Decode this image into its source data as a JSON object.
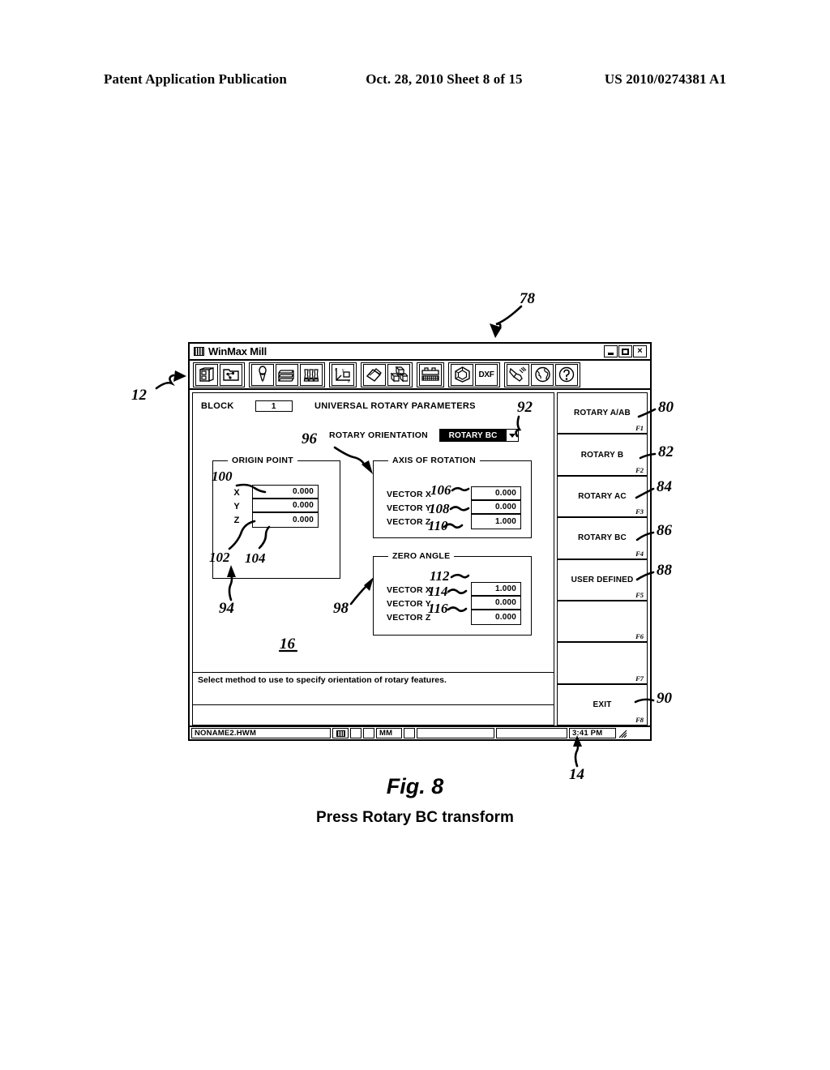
{
  "patent_header": {
    "left": "Patent Application Publication",
    "middle": "Oct. 28, 2010  Sheet 8 of 15",
    "right": "US 2010/0274381 A1"
  },
  "window": {
    "title": "WinMax Mill",
    "title_icon": "grid-app-icon",
    "controls": [
      {
        "name": "minimize-button",
        "glyph": "minimize"
      },
      {
        "name": "maximize-button",
        "glyph": "maximize"
      },
      {
        "name": "close-button",
        "glyph": "×"
      }
    ]
  },
  "toolbar": {
    "groups": [
      {
        "buttons": [
          {
            "name": "part-setup-icon",
            "icon": "part-setup"
          },
          {
            "name": "program-folder-icon",
            "icon": "program-folder"
          }
        ]
      },
      {
        "buttons": [
          {
            "name": "tool-probe-icon",
            "icon": "tool-probe"
          },
          {
            "name": "tool-table-icon",
            "icon": "tool-table"
          },
          {
            "name": "tool-group-icon",
            "icon": "tool-group"
          }
        ]
      },
      {
        "buttons": [
          {
            "name": "coordinate-axes-icon",
            "icon": "coordinate-axes"
          }
        ]
      },
      {
        "buttons": [
          {
            "name": "edit-program-icon",
            "icon": "edit-program"
          },
          {
            "name": "solid-blocks-icon",
            "icon": "solid-blocks"
          }
        ]
      },
      {
        "buttons": [
          {
            "name": "machine-table-icon",
            "icon": "machine-table"
          }
        ]
      },
      {
        "buttons": [
          {
            "name": "solid-model-icon",
            "icon": "solid-model"
          },
          {
            "name": "dxf-import-icon",
            "icon": "dxf",
            "label": "DXF"
          }
        ]
      },
      {
        "buttons": [
          {
            "name": "manual-hand-icon",
            "icon": "manual-hand"
          },
          {
            "name": "globe-icon",
            "icon": "globe"
          },
          {
            "name": "help-icon",
            "icon": "help"
          }
        ]
      }
    ]
  },
  "screen": {
    "block_label": "BLOCK",
    "block_value": "1",
    "title": "UNIVERSAL ROTARY PARAMETERS",
    "orientation_label": "ROTARY ORIENTATION",
    "orientation_value": "ROTARY BC",
    "dropdown_arrow_icon": "chevron-down-icon"
  },
  "origin_point": {
    "legend": "ORIGIN POINT",
    "rows": [
      {
        "label": "X",
        "value": "0.000"
      },
      {
        "label": "Y",
        "value": "0.000"
      },
      {
        "label": "Z",
        "value": "0.000"
      }
    ]
  },
  "axis_of_rotation": {
    "legend": "AXIS OF ROTATION",
    "rows": [
      {
        "label": "VECTOR X",
        "value": "0.000"
      },
      {
        "label": "VECTOR Y",
        "value": "0.000"
      },
      {
        "label": "VECTOR Z",
        "value": "1.000"
      }
    ]
  },
  "zero_angle": {
    "legend": "ZERO ANGLE",
    "rows": [
      {
        "label": "VECTOR X",
        "value": "1.000"
      },
      {
        "label": "VECTOR Y",
        "value": "0.000"
      },
      {
        "label": "VECTOR Z",
        "value": "0.000"
      }
    ]
  },
  "message": {
    "text": "Select method to use to specify orientation of rotary features."
  },
  "softkeys": [
    {
      "label": "ROTARY A/AB",
      "fkey": "F1"
    },
    {
      "label": "ROTARY B",
      "fkey": "F2"
    },
    {
      "label": "ROTARY AC",
      "fkey": "F3"
    },
    {
      "label": "ROTARY BC",
      "fkey": "F4"
    },
    {
      "label": "USER DEFINED",
      "fkey": "F5"
    },
    {
      "label": "",
      "fkey": "F6"
    },
    {
      "label": "",
      "fkey": "F7"
    },
    {
      "label": "EXIT",
      "fkey": "F8"
    }
  ],
  "statusbar": {
    "filename": "NONAME2.HWM",
    "keyboard_icon": "keypad-icon",
    "units": "MM",
    "time": "3:41 PM",
    "resize_grip_icon": "resize-grip-icon"
  },
  "annotations": [
    {
      "id": "ref-78",
      "text": "78"
    },
    {
      "id": "ref-12",
      "text": "12"
    },
    {
      "id": "ref-92",
      "text": "92"
    },
    {
      "id": "ref-96",
      "text": "96"
    },
    {
      "id": "ref-100",
      "text": "100"
    },
    {
      "id": "ref-102",
      "text": "102"
    },
    {
      "id": "ref-104",
      "text": "104"
    },
    {
      "id": "ref-106",
      "text": "106"
    },
    {
      "id": "ref-108",
      "text": "108"
    },
    {
      "id": "ref-110",
      "text": "110"
    },
    {
      "id": "ref-112",
      "text": "112"
    },
    {
      "id": "ref-114",
      "text": "114"
    },
    {
      "id": "ref-116",
      "text": "116"
    },
    {
      "id": "ref-94",
      "text": "94"
    },
    {
      "id": "ref-98",
      "text": "98"
    },
    {
      "id": "ref-16",
      "text": "16"
    },
    {
      "id": "ref-14",
      "text": "14"
    },
    {
      "id": "ref-80",
      "text": "80"
    },
    {
      "id": "ref-82",
      "text": "82"
    },
    {
      "id": "ref-84",
      "text": "84"
    },
    {
      "id": "ref-86",
      "text": "86"
    },
    {
      "id": "ref-88",
      "text": "88"
    },
    {
      "id": "ref-90",
      "text": "90"
    }
  ],
  "figure": {
    "number": "Fig. 8",
    "subtitle": "Press Rotary BC transform"
  }
}
